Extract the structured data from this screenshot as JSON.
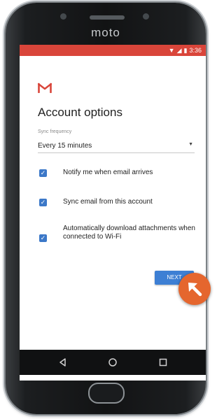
{
  "device": {
    "brand": "moto"
  },
  "status_bar": {
    "time": "3:36",
    "color": "#d9453a"
  },
  "account_options": {
    "title": "Account options",
    "sync_frequency_label": "Sync frequency",
    "sync_frequency_value": "Every 15 minutes",
    "options": [
      {
        "label": "Notify me when email arrives",
        "checked": true
      },
      {
        "label": "Sync email from this account",
        "checked": true
      },
      {
        "label": "Automatically download attachments when connected to Wi-Fi",
        "checked": true
      }
    ],
    "next_label": "NEXT"
  },
  "nav_icons": [
    "back-icon",
    "home-icon",
    "recents-icon"
  ],
  "colors": {
    "accent_blue": "#3c78c8",
    "gmail_red": "#d9453a",
    "fab_orange": "#e5662e"
  }
}
